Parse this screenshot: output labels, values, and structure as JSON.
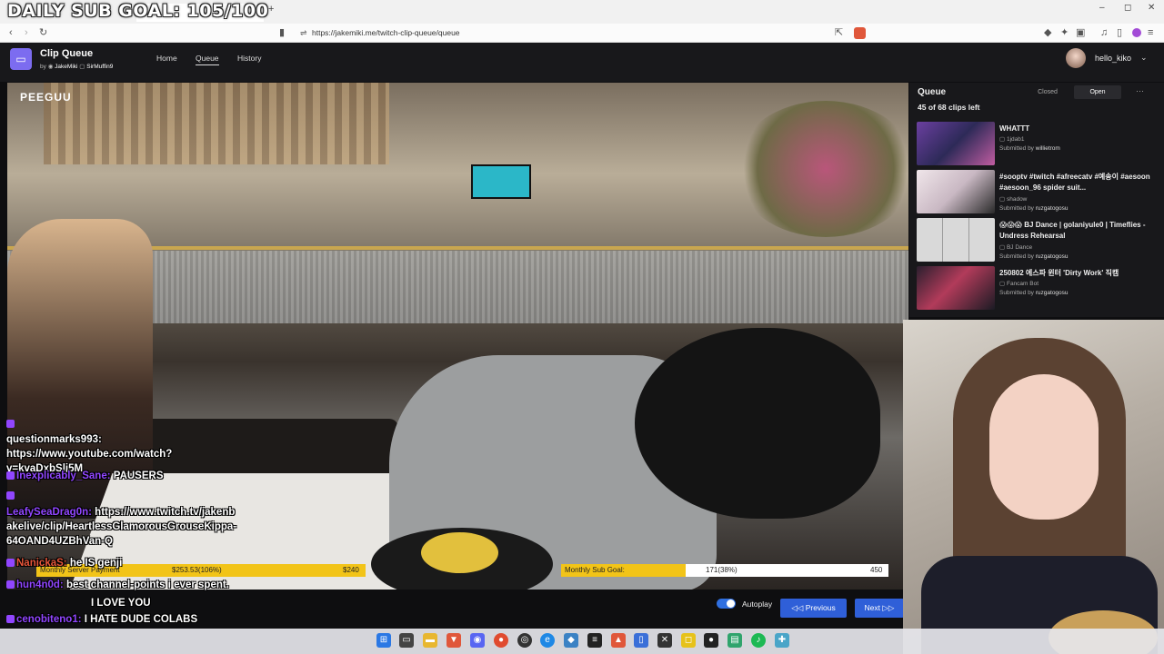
{
  "overlay": {
    "sub_goal": "DAILY SUB GOAL: 105/100"
  },
  "browser": {
    "url": "https://jakemiki.me/twitch-clip-queue/queue",
    "win_min": "–",
    "win_max": "◻",
    "win_close": "✕",
    "tab_close": "✕",
    "new_tab": "+"
  },
  "app": {
    "title": "Clip Queue",
    "by": "by",
    "author1": "JakeMiki",
    "author2": "SirMuffin9",
    "nav": [
      "Home",
      "Queue",
      "History"
    ],
    "username": "hello_kiko",
    "accent": "#2f5fd8"
  },
  "video": {
    "watermark": "PEEGUU",
    "bars": {
      "server_label": "Monthly Server Payment",
      "server_value": "$253.53(106%)",
      "server_goal": "$240",
      "server_fill": 1.0,
      "sub_label": "Monthly Sub Goal:",
      "sub_value": "171(38%)",
      "sub_goal": "450",
      "sub_fill": 0.38
    }
  },
  "chat": [
    {
      "user": "questionmarks993:",
      "msg": "https://www.youtube.com/watch?v=kvaDxbSlj5M",
      "color": "#ffffff"
    },
    {
      "user": "Inexplicably_Sane:",
      "msg": "PAUSERS",
      "color": "#9146ff"
    },
    {
      "user": "LeafySeaDrag0n:",
      "msg": "https://www.twitch.tv/jakenbakelive/clip/HeartlessGlamorousGrouseKippa-64OAND4UZBhVan-Q",
      "color": "#9146ff"
    },
    {
      "user": "NanickaS:",
      "msg": "he IS genji",
      "color": "#e6553a"
    },
    {
      "user": "hun4n0d:",
      "msg": "best channel-points i ever spent.",
      "color": "#9146ff"
    },
    {
      "user": "",
      "msg": "I LOVE YOU",
      "color": "#ffffff"
    },
    {
      "user": "cenobiteno1:",
      "msg": "I HATE DUDE COLABS",
      "color": "#9146ff"
    }
  ],
  "controls": {
    "autoplay": "Autoplay",
    "previous": "Previous",
    "next": "Next",
    "autoplay_on": true
  },
  "queue": {
    "title": "Queue",
    "closed": "Closed",
    "open": "Open",
    "more": "···",
    "clips_left": "45 of 68 clips left",
    "items": [
      {
        "title": "WHATTT",
        "channel": "1jdab1",
        "submitted_by": "Submitted by",
        "submitter": "willietrom"
      },
      {
        "title": "#sooptv #twitch #afreecatv #예송이 #aesoon #aesoon_96 spider suit...",
        "channel": "shadow",
        "submitted_by": "Submitted by",
        "submitter": "ruzgatogosu"
      },
      {
        "title": "😱😱😱 BJ Dance | golaniyule0 | Timeflies - Undress Rehearsal",
        "channel": "BJ Dance",
        "submitted_by": "Submitted by",
        "submitter": "ruzgatogosu"
      },
      {
        "title": "250802 에스파 윈터 'Dirty Work' 직캠",
        "channel": "Fancam Bot",
        "submitted_by": "Submitted by",
        "submitter": "ruzgatogosu"
      }
    ]
  }
}
